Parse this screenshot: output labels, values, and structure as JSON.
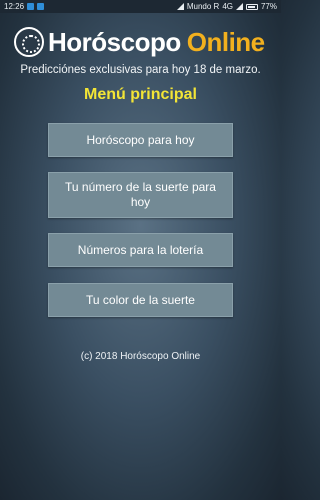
{
  "status_bar": {
    "time": "12:26",
    "carrier": "Mundo R",
    "network": "4G",
    "battery": "77%"
  },
  "logo": {
    "main": "Horóscopo",
    "accent": "Online",
    "accent_color": "#f2b01e"
  },
  "subtitle": "Predicciónes exclusivas para hoy 18 de marzo.",
  "menu": {
    "title": "Menú principal",
    "title_color": "#f3e536",
    "items": [
      {
        "label": "Horóscopo para hoy"
      },
      {
        "label": "Tu número de la suerte para hoy"
      },
      {
        "label": "Números para la lotería"
      },
      {
        "label": "Tu color de la suerte"
      }
    ]
  },
  "footer": "(c) 2018 Horóscopo Online"
}
